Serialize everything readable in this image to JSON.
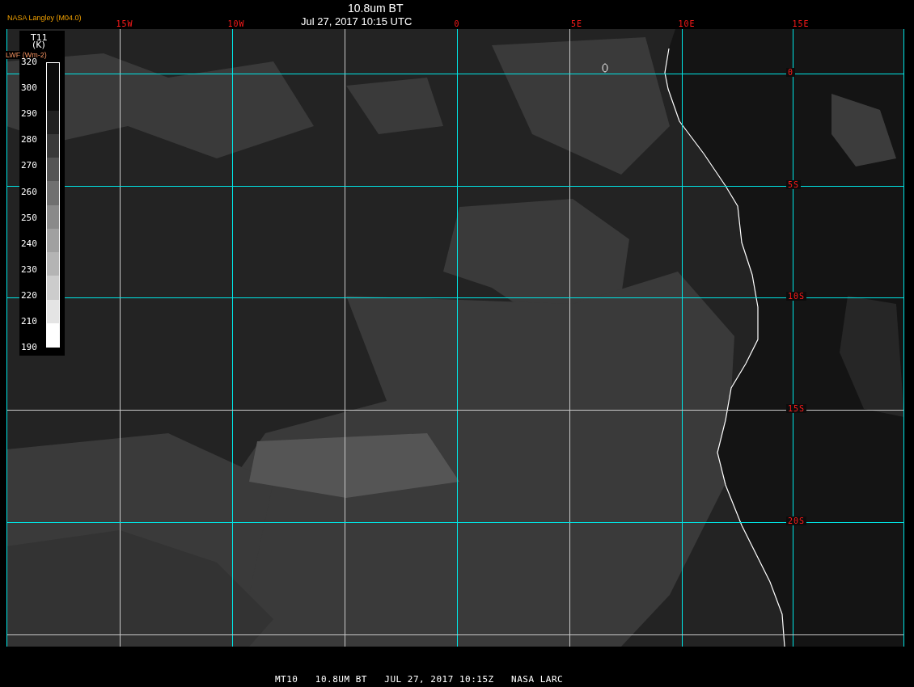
{
  "header": {
    "source": "NASA Langley (M04.0)",
    "title": "10.8um BT",
    "timestamp": "Jul 27, 2017 10:15 UTC"
  },
  "legend": {
    "title": "T11",
    "unit": "(K)",
    "overlay_label": "LWF (Wm-2)",
    "values": [
      "320",
      "300",
      "290",
      "280",
      "270",
      "260",
      "250",
      "240",
      "230",
      "220",
      "210",
      "190"
    ]
  },
  "longitude_labels": [
    "15W",
    "10W",
    "0",
    "5E",
    "10E",
    "15E"
  ],
  "latitude_labels": [
    "0",
    "5S",
    "10S",
    "15S",
    "20S"
  ],
  "footer": {
    "caption": "MT10   10.8UM BT   JUL 27, 2017 10:15Z   NASA LARC"
  }
}
